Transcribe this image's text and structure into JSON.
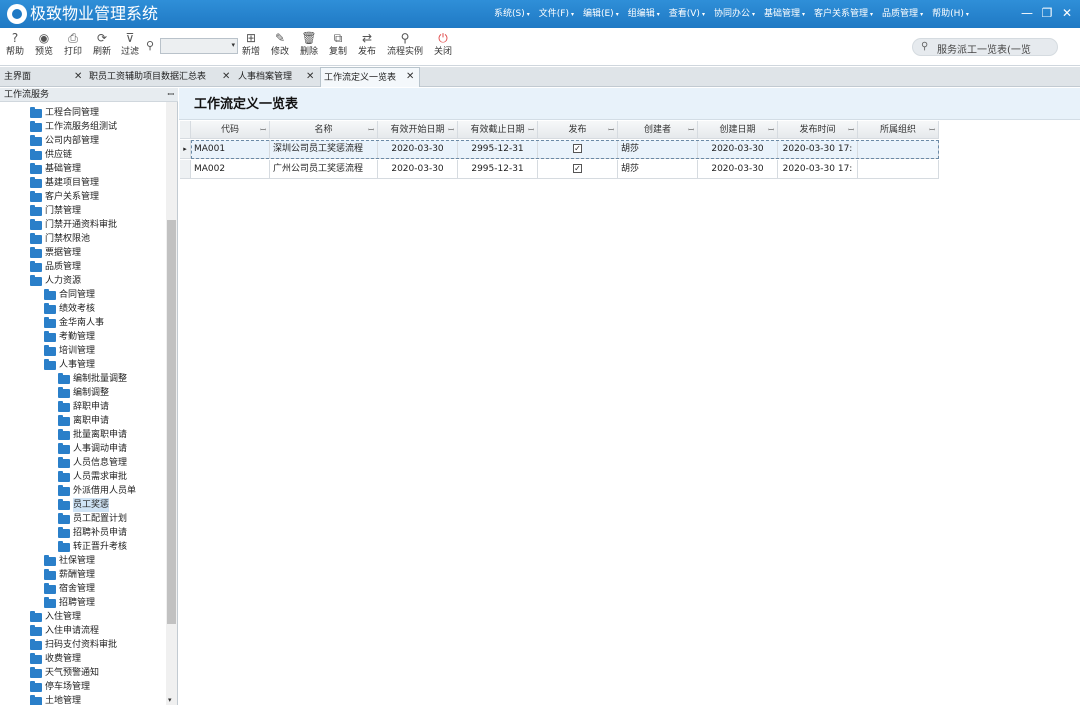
{
  "app": {
    "title": "极致物业管理系统"
  },
  "menu": [
    {
      "label": "系统(S)"
    },
    {
      "label": "文件(F)"
    },
    {
      "label": "编辑(E)"
    },
    {
      "label": "组编辑"
    },
    {
      "label": "查看(V)"
    },
    {
      "label": "协同办公"
    },
    {
      "label": "基础管理"
    },
    {
      "label": "客户关系管理"
    },
    {
      "label": "品质管理"
    },
    {
      "label": "帮助(H)"
    }
  ],
  "window_controls": {
    "minimize": "—",
    "restore": "❐",
    "close": "✕"
  },
  "toolbar": {
    "buttons": [
      {
        "label": "帮助",
        "icon": "?"
      },
      {
        "label": "预览",
        "icon": "◉"
      },
      {
        "label": "打印",
        "icon": "⎙"
      },
      {
        "label": "刷新",
        "icon": "⟳"
      },
      {
        "label": "过滤",
        "icon": "⊽"
      },
      {
        "label": "新增",
        "icon": "⊞"
      },
      {
        "label": "修改",
        "icon": "✎"
      },
      {
        "label": "删除",
        "icon": "🗑"
      },
      {
        "label": "复制",
        "icon": "⧉"
      },
      {
        "label": "发布",
        "icon": "⇄"
      },
      {
        "label": "流程实例",
        "icon": "⚲"
      },
      {
        "label": "关闭",
        "icon": "⏻"
      }
    ],
    "search_icon": "⚲",
    "combo_value": "",
    "combo_arrow": "▾",
    "global_search": {
      "icon": "⚲",
      "text": "服务派工一览表(一览"
    }
  },
  "tabs": [
    {
      "label": "主界面",
      "close": "✕"
    },
    {
      "label": "职员工资辅助项目数据汇总表",
      "close": "✕"
    },
    {
      "label": "人事档案管理",
      "close": "✕"
    },
    {
      "label": "工作流定义一览表",
      "close": "✕"
    }
  ],
  "sidebar": {
    "title": "工作流服务",
    "pin": "ꟷ",
    "tree": [
      {
        "label": "工程合同管理",
        "level": 0
      },
      {
        "label": "工作流服务组测试",
        "level": 0
      },
      {
        "label": "公司内部管理",
        "level": 0
      },
      {
        "label": "供应链",
        "level": 0
      },
      {
        "label": "基础管理",
        "level": 0
      },
      {
        "label": "基建项目管理",
        "level": 0
      },
      {
        "label": "客户关系管理",
        "level": 0
      },
      {
        "label": "门禁管理",
        "level": 0
      },
      {
        "label": "门禁开通资料审批",
        "level": 0
      },
      {
        "label": "门禁权限池",
        "level": 0
      },
      {
        "label": "票据管理",
        "level": 0
      },
      {
        "label": "品质管理",
        "level": 0
      },
      {
        "label": "人力资源",
        "level": 0
      },
      {
        "label": "合同管理",
        "level": 1
      },
      {
        "label": "绩效考核",
        "level": 1
      },
      {
        "label": "金华南人事",
        "level": 1
      },
      {
        "label": "考勤管理",
        "level": 1
      },
      {
        "label": "培训管理",
        "level": 1
      },
      {
        "label": "人事管理",
        "level": 1
      },
      {
        "label": "编制批量调整",
        "level": 2
      },
      {
        "label": "编制调整",
        "level": 2
      },
      {
        "label": "辞职申请",
        "level": 2
      },
      {
        "label": "离职申请",
        "level": 2
      },
      {
        "label": "批量离职申请",
        "level": 2
      },
      {
        "label": "人事调动申请",
        "level": 2
      },
      {
        "label": "人员信息管理",
        "level": 2
      },
      {
        "label": "人员需求审批",
        "level": 2
      },
      {
        "label": "外派借用人员单",
        "level": 2
      },
      {
        "label": "员工奖惩",
        "level": 2,
        "selected": true
      },
      {
        "label": "员工配置计划",
        "level": 2
      },
      {
        "label": "招聘补员申请",
        "level": 2
      },
      {
        "label": "转正晋升考核",
        "level": 2
      },
      {
        "label": "社保管理",
        "level": 1
      },
      {
        "label": "薪酬管理",
        "level": 1
      },
      {
        "label": "宿舍管理",
        "level": 1
      },
      {
        "label": "招聘管理",
        "level": 1
      },
      {
        "label": "入住管理",
        "level": 0
      },
      {
        "label": "入住申请流程",
        "level": 0
      },
      {
        "label": "扫码支付资料审批",
        "level": 0
      },
      {
        "label": "收费管理",
        "level": 0
      },
      {
        "label": "天气预警通知",
        "level": 0
      },
      {
        "label": "停车场管理",
        "level": 0
      },
      {
        "label": "土地管理",
        "level": 0
      }
    ],
    "scroll_arrow": "▾"
  },
  "main": {
    "title": "工作流定义一览表",
    "grid": {
      "columns": [
        {
          "label": "代码"
        },
        {
          "label": "名称"
        },
        {
          "label": "有效开始日期"
        },
        {
          "label": "有效截止日期"
        },
        {
          "label": "发布"
        },
        {
          "label": "创建者"
        },
        {
          "label": "创建日期"
        },
        {
          "label": "发布时间"
        },
        {
          "label": "所属组织"
        }
      ],
      "pin_glyph": "ꟷ",
      "row_indicator": "▸",
      "check_glyph": "✓",
      "rows": [
        {
          "code": "MA001",
          "name": "深圳公司员工奖惩流程",
          "start": "2020-03-30",
          "end": "2995-12-31",
          "published": true,
          "creator": "胡莎",
          "created": "2020-03-30",
          "publish_time": "2020-03-30 17:",
          "org": ""
        },
        {
          "code": "MA002",
          "name": "广州公司员工奖惩流程",
          "start": "2020-03-30",
          "end": "2995-12-31",
          "published": true,
          "creator": "胡莎",
          "created": "2020-03-30",
          "publish_time": "2020-03-30 17:",
          "org": ""
        }
      ]
    }
  }
}
